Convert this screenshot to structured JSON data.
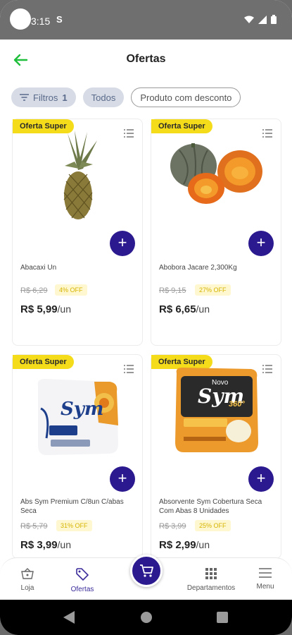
{
  "statusbar": {
    "time": "3:15",
    "sim_icon": "S"
  },
  "header": {
    "title": "Ofertas"
  },
  "chips": {
    "filter_label": "Filtros",
    "filter_count": "1",
    "all_label": "Todos",
    "discount_label": "Produto com desconto"
  },
  "products": [
    {
      "badge": "Oferta Super",
      "name": "Abacaxi Un",
      "old_price": "R$ 6,29",
      "discount": "4% OFF",
      "price": "R$ 5,99",
      "unit": "/un"
    },
    {
      "badge": "Oferta Super",
      "name": "Abobora Jacare 2,300Kg",
      "old_price": "R$ 9,15",
      "discount": "27% OFF",
      "price": "R$ 6,65",
      "unit": "/un"
    },
    {
      "badge": "Oferta Super",
      "name": "Abs Sym Premium C/8un C/abas Seca",
      "old_price": "R$ 5,79",
      "discount": "31% OFF",
      "price": "R$ 3,99",
      "unit": "/un"
    },
    {
      "badge": "Oferta Super",
      "name": "Absorvente Sym Cobertura Seca Com Abas 8 Unidades",
      "old_price": "R$ 3,99",
      "discount": "25% OFF",
      "price": "R$ 2,99",
      "unit": "/un"
    }
  ],
  "product_images": {
    "p3_brand": "Sym",
    "p4_new": "Novo",
    "p4_brand": "Sym",
    "p4_360": "360°"
  },
  "nav": {
    "store": "Loja",
    "offers": "Ofertas",
    "departments": "Departamentos",
    "menu": "Menu"
  },
  "colors": {
    "primary": "#2b1a8f",
    "badge": "#f5dc1b",
    "back_arrow": "#1fbf3c"
  }
}
